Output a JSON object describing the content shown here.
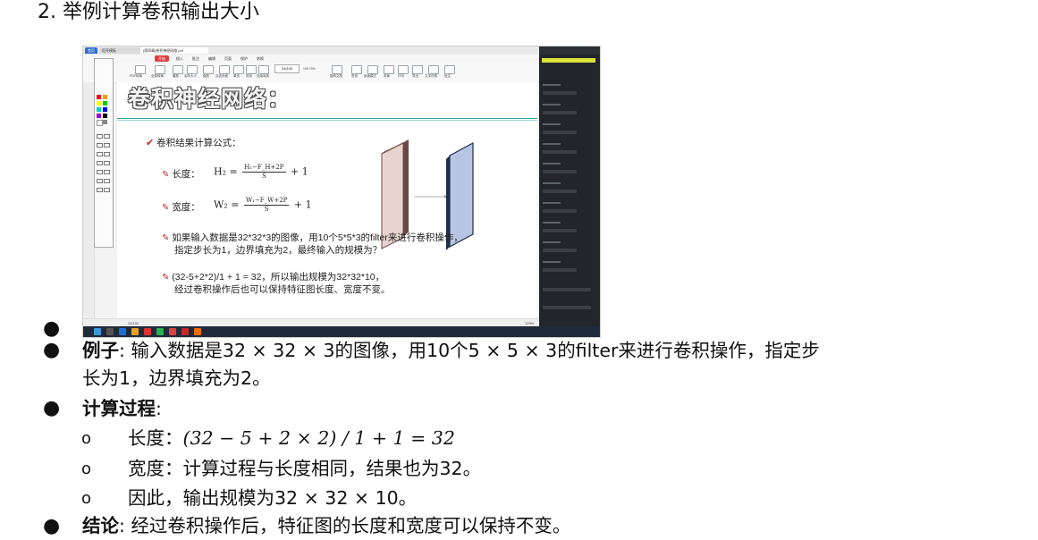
{
  "heading": "2. 举例计算卷积输出大小",
  "screenshot": {
    "tabs": [
      "首页",
      "稻壳模板",
      "[第四章]卷积神经网络.pdf"
    ],
    "menu": {
      "active": "开始",
      "items": [
        "插入",
        "批注",
        "编辑",
        "页面",
        "保护",
        "转换"
      ]
    },
    "ribbon": {
      "labels": [
        "PDF转换",
        "全部转换",
        "播放",
        "实际大小",
        "缩放",
        "合适页面",
        "单页",
        "双页",
        "连续阅读",
        "旋转文档",
        "查找",
        "阅读模式",
        "背景",
        "打印",
        "导出",
        "文字识别",
        "批注"
      ],
      "page_indicator": "24/100",
      "zoom": "129.70%"
    },
    "palette_colors": [
      "#ff0000",
      "#ff9900",
      "#ffff00",
      "#00cc00",
      "#00cccc",
      "#0000ff",
      "#9900cc",
      "#000000",
      "#ffffff",
      "#888888"
    ],
    "slide": {
      "title": "卷积神经网络：",
      "intro": "卷积结果计算公式：",
      "length_label": "长度：",
      "width_label": "宽度：",
      "length_formula": {
        "lhs": "H₂ =",
        "num": "H₁−F_H+2P",
        "den": "S",
        "tail": "+ 1"
      },
      "width_formula": {
        "lhs": "W₂ =",
        "num": "W₁−F_W+2P",
        "den": "S",
        "tail": "+ 1"
      },
      "q_line1": "如果输入数据是32*32*3的图像，用10个5*5*3的filter来进行卷积操作，",
      "q_line2": "指定步长为1，边界填充为2，最终输入的规模为？",
      "a_line1": "(32-5+2*2)/1 + 1 = 32，所以输出规模为32*32*10，",
      "a_line2": "经过卷积操作后也可以保持特征图长度、宽度不变。"
    },
    "footer_page": "24/100",
    "footer_zoom": "129%"
  },
  "bullets": {
    "example_label": "例子",
    "example_text": ": 输入数据是32 × 32 × 3的图像，用10个5 × 5 × 3的filter来进行卷积操作，指定步",
    "example_text2": "长为1，边界填充为2。",
    "process_label": "计算过程",
    "process_colon": ":",
    "sub1_label": "长度：",
    "sub1_math": "(32 − 5 + 2 × 2) / 1 + 1 = 32",
    "sub2": "宽度：计算过程与长度相同，结果也为32。",
    "sub3": "因此，输出规模为32 × 32 × 10。",
    "conclusion_label": "结论",
    "conclusion_text": ": 经过卷积操作后，特征图的长度和宽度可以保持不变。"
  },
  "colors": {
    "accent_red": "#c0272d",
    "teal_rule": "#2aa6a6",
    "input_block": "#e8d3cf",
    "output_block": "#b8c6e4",
    "tab_blue": "#2d6ccf",
    "panel_dark": "#22262c"
  },
  "icons": [
    "check-icon",
    "pencil-icon",
    "arrow-right-icon",
    "bullet-icon",
    "sub-bullet-icon"
  ]
}
